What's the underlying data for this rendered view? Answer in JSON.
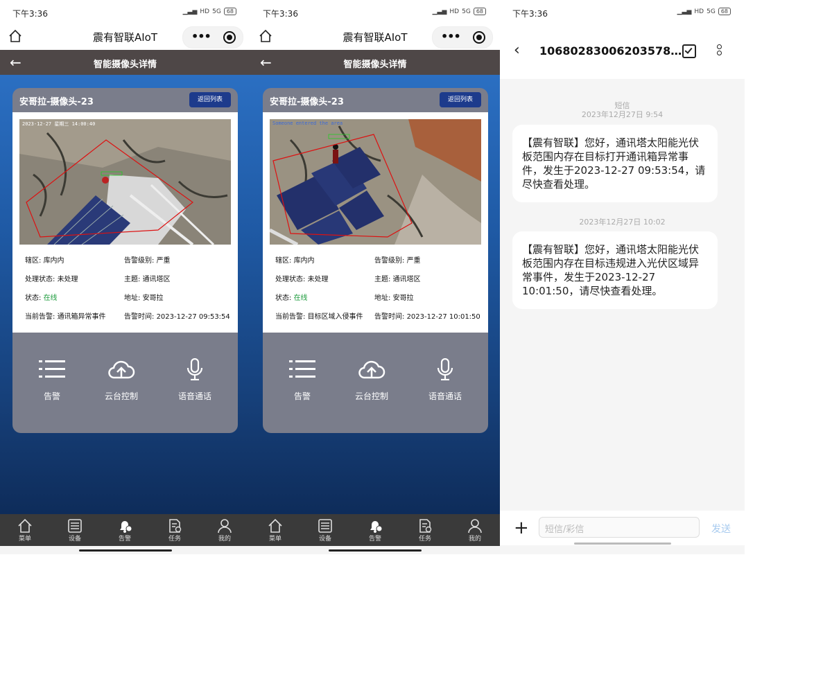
{
  "status": {
    "time": "下午3:36",
    "net_badge": "HD",
    "signal": "5G",
    "battery": "68"
  },
  "miniapp": {
    "title": "震有智联AIoT"
  },
  "page": {
    "title": "智能摄像头详情"
  },
  "labels": {
    "return_list": "返回列表",
    "zone": "辖区: ",
    "level": "告警级别: ",
    "handle": "处理状态: ",
    "topic": "主题: ",
    "state": "状态: ",
    "address": "地址: ",
    "current_alarm": "当前告警: ",
    "alarm_time": "告警时间: "
  },
  "screens": [
    {
      "camera_name": "安哥拉-摄像头-23",
      "overlay_text": "2023-12-27 星期三 14:00:40",
      "zone": "库内内",
      "level": "严重",
      "handle": "未处理",
      "topic": "通讯塔区",
      "state": "在线",
      "address": "安哥拉",
      "current_alarm": "通讯箱异常事件",
      "alarm_time": "2023-12-27 09:53:54"
    },
    {
      "camera_name": "安哥拉-摄像头-23",
      "overlay_text": "Someone entered the area",
      "zone": "库内内",
      "level": "严重",
      "handle": "未处理",
      "topic": "通讯塔区",
      "state": "在线",
      "address": "安哥拉",
      "current_alarm": "目标区域入侵事件",
      "alarm_time": "2023-12-27 10:01:50"
    }
  ],
  "actions": [
    {
      "label": "告警",
      "icon": "list-icon"
    },
    {
      "label": "云台控制",
      "icon": "cloud-upload-icon"
    },
    {
      "label": "语音通话",
      "icon": "microphone-icon"
    }
  ],
  "tabs": [
    {
      "label": "菜单",
      "icon": "home-icon"
    },
    {
      "label": "设备",
      "icon": "device-icon"
    },
    {
      "label": "告警",
      "icon": "alarm-bell-icon",
      "active": true
    },
    {
      "label": "任务",
      "icon": "task-icon"
    },
    {
      "label": "我的",
      "icon": "profile-icon"
    }
  ],
  "sms": {
    "number": "10680283006203578…",
    "type_label": "短信",
    "messages": [
      {
        "time": "2023年12月27日 9:54",
        "text": "【震有智联】您好，通讯塔太阳能光伏板范围内存在目标打开通讯箱异常事件，发生于2023-12-27  09:53:54，请尽快查看处理。"
      },
      {
        "time": "2023年12月27日 10:02",
        "text": "【震有智联】您好，通讯塔太阳能光伏板范围内存在目标违规进入光伏区域异常事件，发生于2023-12-27    10:01:50，请尽快查看处理。"
      }
    ],
    "input_placeholder": "短信/彩信",
    "send_label": "发送"
  },
  "colors": {
    "header": "#4e4747",
    "card": "#7a7d8b",
    "return_btn": "#1d3b8c",
    "online": "#1a9a3a",
    "tabbar": "#3a3a3a"
  }
}
